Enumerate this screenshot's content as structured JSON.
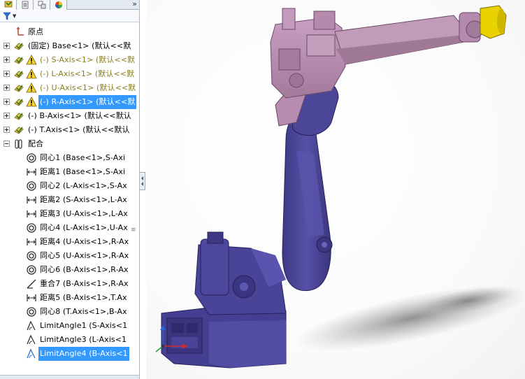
{
  "tabs": [
    {
      "name": "feature-manager",
      "icon": "feature-tree-icon"
    },
    {
      "name": "property-manager",
      "icon": "property-sheet-icon"
    },
    {
      "name": "configuration-manager",
      "icon": "configuration-icon"
    },
    {
      "name": "display-manager",
      "icon": "appearance-icon"
    }
  ],
  "tab_expand_label": "»",
  "tree": {
    "origin": "原点",
    "components": [
      {
        "label": "(固定) Base<1> (默认<<默",
        "warning": false,
        "selected": false
      },
      {
        "label": "(-) S-Axis<1> (默认<<默",
        "warning": true,
        "selected": false
      },
      {
        "label": "(-) L-Axis<1> (默认<<默",
        "warning": true,
        "selected": false
      },
      {
        "label": "(-) U-Axis<1> (默认<<默",
        "warning": true,
        "selected": false
      },
      {
        "label": "(-) R-Axis<1> (默认<<默",
        "warning": true,
        "selected": true
      },
      {
        "label": "(-) B-Axis<1> (默认<<默认",
        "warning": false,
        "selected": false
      },
      {
        "label": "(-) T.Axis<1> (默认<<默认",
        "warning": false,
        "selected": false
      }
    ],
    "mates_folder": "配合",
    "mates": [
      {
        "type": "concentric",
        "label": "同心1 (Base<1>,S-Axi",
        "selected": false
      },
      {
        "type": "distance",
        "label": "距离1 (Base<1>,S-Axi",
        "selected": false
      },
      {
        "type": "concentric",
        "label": "同心2 (L-Axis<1>,S-Ax",
        "selected": false
      },
      {
        "type": "distance",
        "label": "距离2 (S-Axis<1>,L-Ax",
        "selected": false
      },
      {
        "type": "distance",
        "label": "距离3 (U-Axis<1>,L-Ax",
        "selected": false
      },
      {
        "type": "concentric",
        "label": "同心4 (L-Axis<1>,U-Ax",
        "selected": false
      },
      {
        "type": "distance",
        "label": "距离4 (U-Axis<1>,R-Ax",
        "selected": false
      },
      {
        "type": "concentric",
        "label": "同心5 (U-Axis<1>,R-Ax",
        "selected": false
      },
      {
        "type": "concentric",
        "label": "同心6 (B-Axis<1>,R-Ax",
        "selected": false
      },
      {
        "type": "coincident",
        "label": "重合7 (B-Axis<1>,R-Ax",
        "selected": false
      },
      {
        "type": "distance",
        "label": "距离5 (B-Axis<1>,T.Ax",
        "selected": false
      },
      {
        "type": "concentric",
        "label": "同心8 (T.Axis<1>,B-Ax",
        "selected": false
      },
      {
        "type": "limit-angle",
        "label": "LimitAngle1 (S-Axis<1",
        "selected": false
      },
      {
        "type": "limit-angle",
        "label": "LimitAngle3 (L-Axis<1",
        "selected": false
      },
      {
        "type": "limit-angle",
        "label": "LimitAngle4 (B-Axis<1",
        "selected": true
      }
    ]
  },
  "colors": {
    "selection": "#3399ff",
    "warning_text": "#8a7d1c",
    "robot_pink": "#b98bb0",
    "robot_purple": "#4f4a9c",
    "robot_yellow": "#e9d200"
  }
}
